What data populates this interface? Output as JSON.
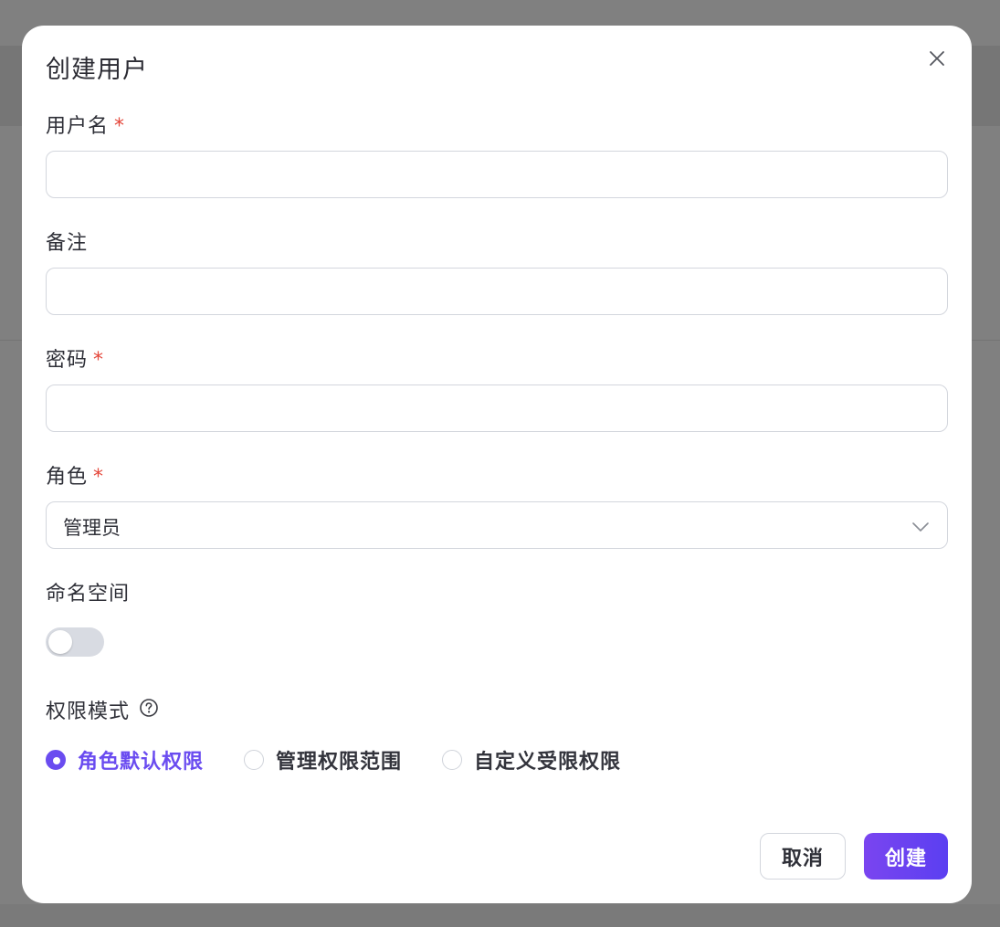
{
  "dialog": {
    "title": "创建用户"
  },
  "fields": {
    "username": {
      "label": "用户名",
      "required_mark": "*",
      "value": ""
    },
    "remark": {
      "label": "备注",
      "value": ""
    },
    "password": {
      "label": "密码",
      "required_mark": "*",
      "value": ""
    },
    "role": {
      "label": "角色",
      "required_mark": "*",
      "selected": "管理员"
    },
    "namespace": {
      "label": "命名空间",
      "toggle_on": false
    },
    "permission_mode": {
      "label": "权限模式",
      "options": [
        {
          "label": "角色默认权限",
          "checked": true
        },
        {
          "label": "管理权限范围",
          "checked": false
        },
        {
          "label": "自定义受限权限",
          "checked": false
        }
      ]
    }
  },
  "actions": {
    "cancel_label": "取消",
    "create_label": "创建"
  },
  "colors": {
    "accent": "#6a4cf0",
    "required": "#e4463a",
    "overlay": "#808080"
  },
  "icons": {
    "close": "close-icon",
    "select": "chevron-down-icon",
    "help": "question-circle-icon"
  }
}
